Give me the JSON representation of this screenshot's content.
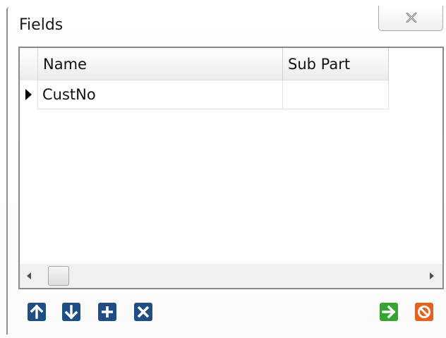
{
  "window": {
    "title": "Fields"
  },
  "grid": {
    "columns": [
      {
        "label": "Name"
      },
      {
        "label": "Sub Part"
      }
    ],
    "rows": [
      {
        "name": "CustNo",
        "sub_part": ""
      }
    ]
  },
  "icons": {
    "close": "close-icon",
    "row_indicator": "current-row-triangle-icon",
    "move_up": "arrow-up-icon",
    "move_down": "arrow-down-icon",
    "add": "plus-icon",
    "remove": "x-icon",
    "ok": "arrow-right-icon",
    "cancel": "no-entry-icon"
  },
  "colors": {
    "tool_button_blue": "#1f4e86",
    "ok_green": "#36a431",
    "cancel_orange": "#e8601a"
  }
}
